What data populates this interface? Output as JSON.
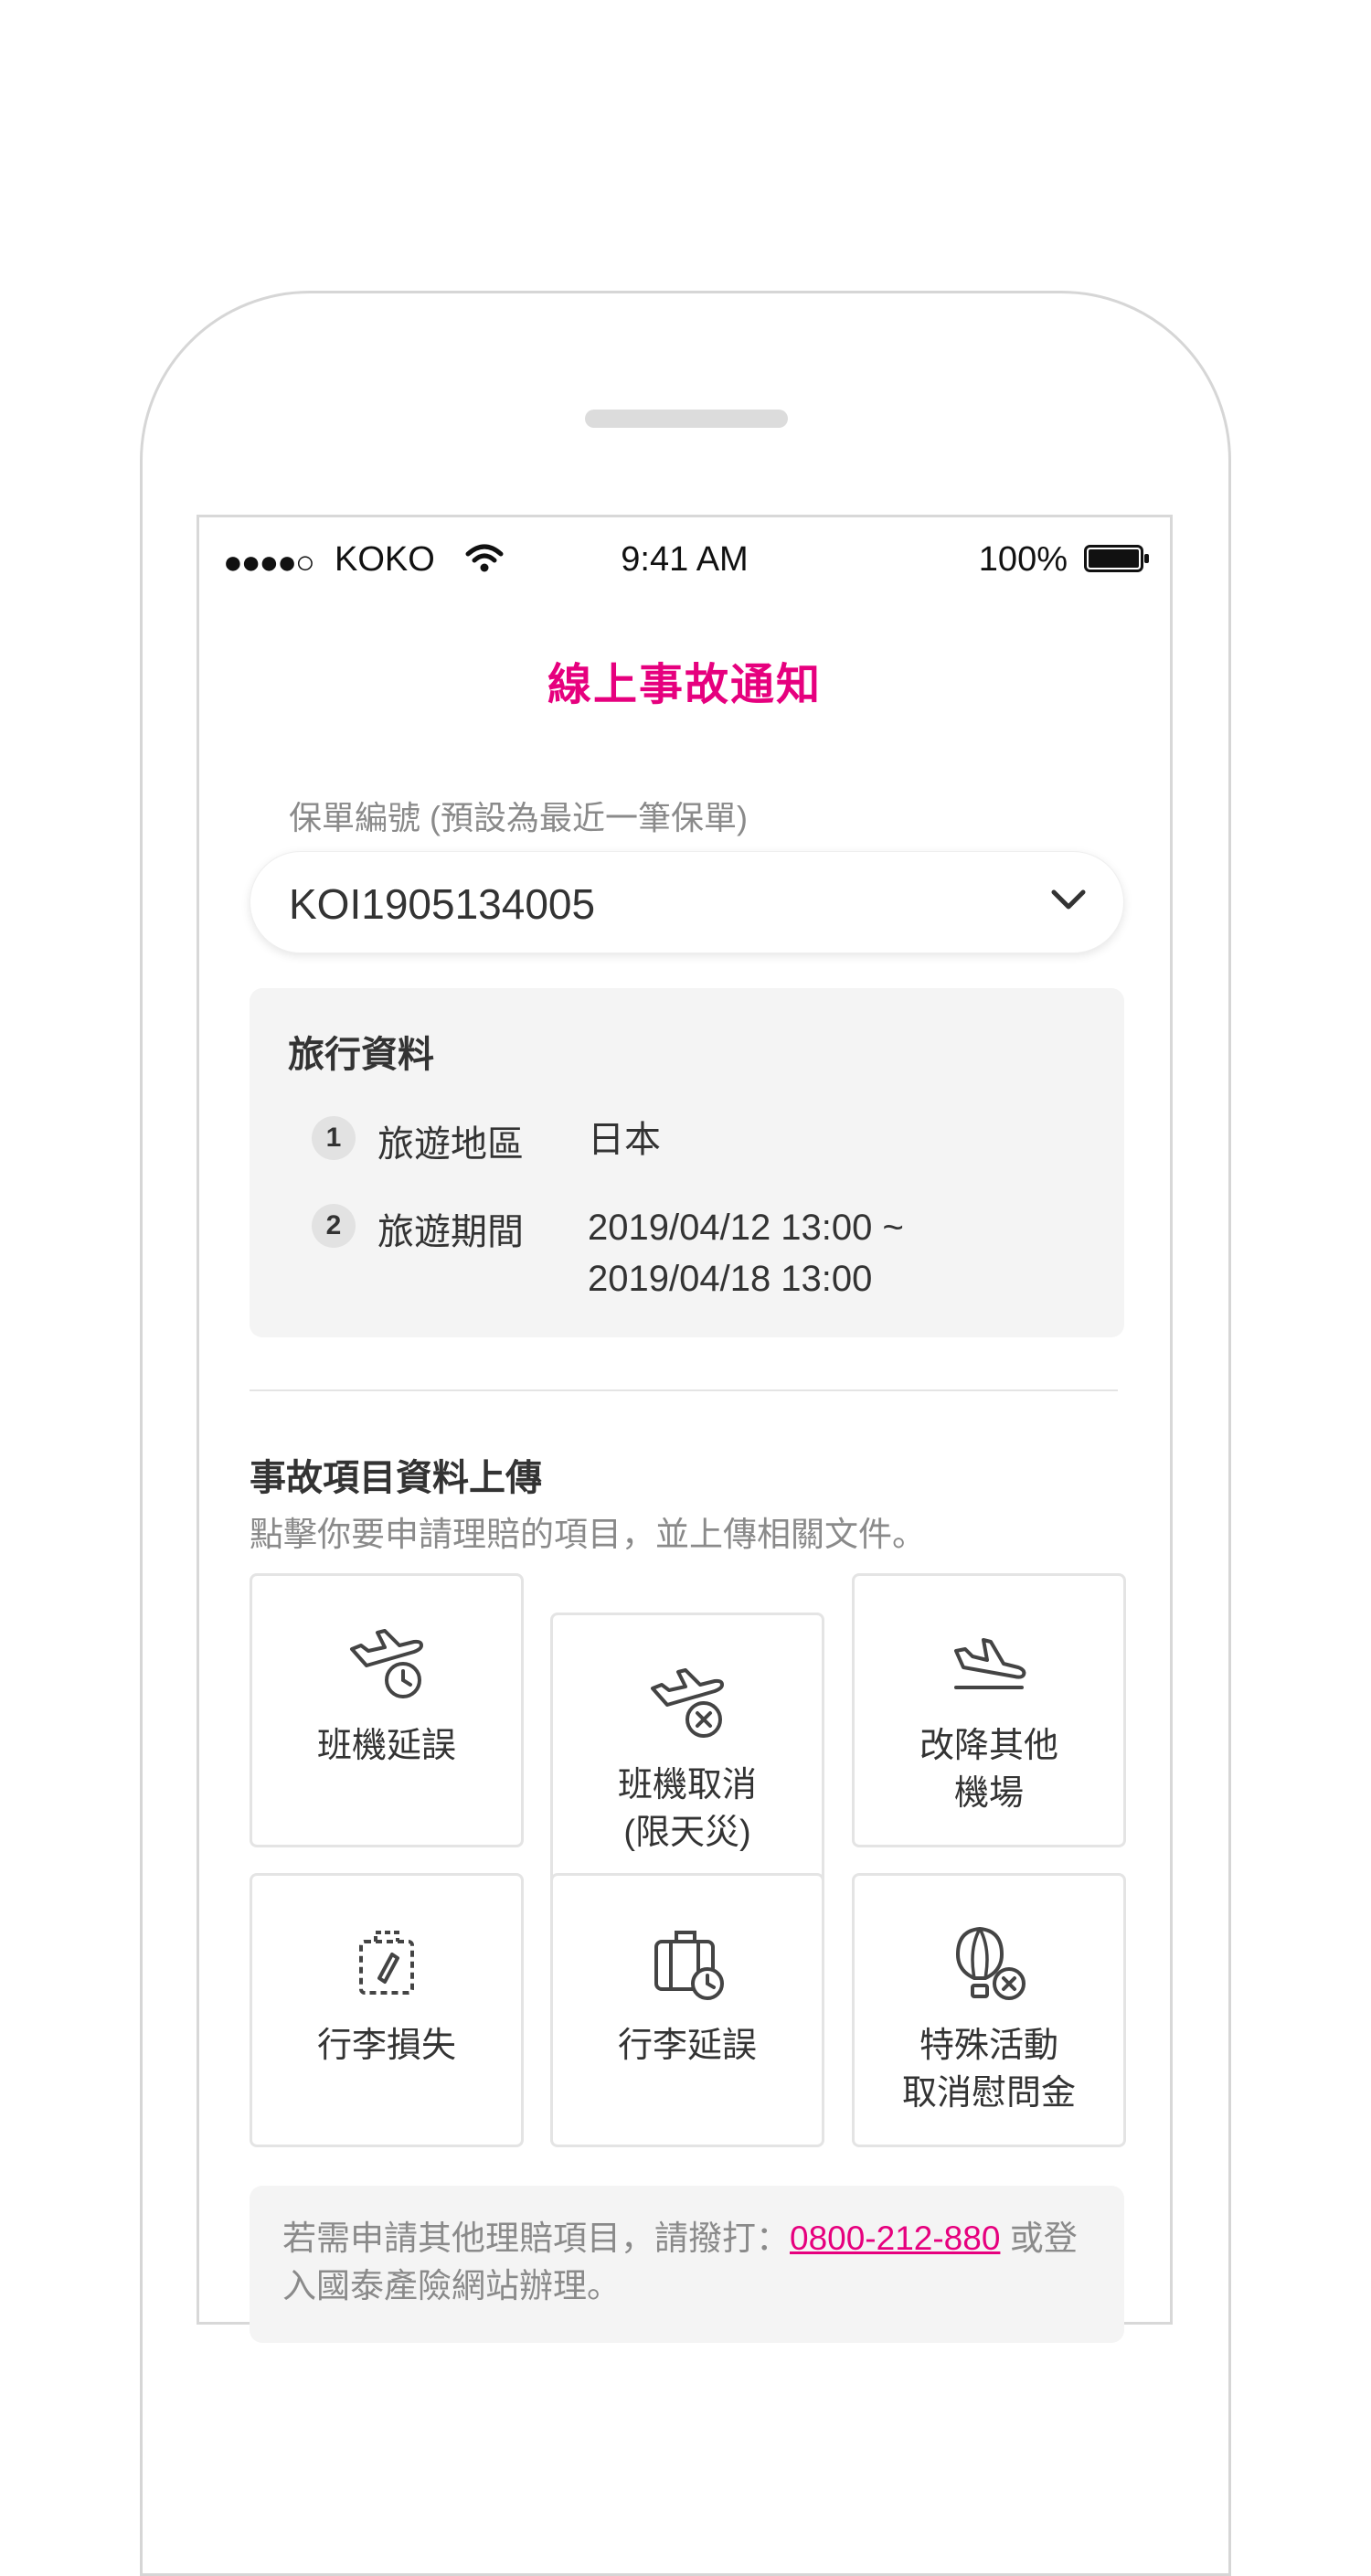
{
  "status_bar": {
    "signal": "●●●●○",
    "carrier": "KOKO",
    "time": "9:41 AM",
    "battery_pct": "100%"
  },
  "page": {
    "title": "線上事故通知"
  },
  "policy": {
    "label": "保單編號 (預設為最近一筆保單)",
    "value": "KOI1905134005"
  },
  "trip": {
    "heading": "旅行資料",
    "rows": [
      {
        "num": "1",
        "key": "旅遊地區",
        "value": "日本"
      },
      {
        "num": "2",
        "key": "旅遊期間",
        "value_line1": "2019/04/12 13:00 ~",
        "value_line2": "2019/04/18 13:00"
      }
    ]
  },
  "incident": {
    "title": "事故項目資料上傳",
    "desc": "點擊你要申請理賠的項目，並上傳相關文件。",
    "items": [
      {
        "label": "班機延誤",
        "icon": "flight-delay-icon"
      },
      {
        "label": "班機取消\n(限天災)",
        "icon": "flight-cancel-icon"
      },
      {
        "label": "改降其他\n機場",
        "icon": "plane-landing-icon"
      },
      {
        "label": "行李損失",
        "icon": "luggage-loss-icon"
      },
      {
        "label": "行李延誤",
        "icon": "luggage-delay-icon"
      },
      {
        "label": "特殊活動\n取消慰問金",
        "icon": "balloon-cancel-icon"
      }
    ]
  },
  "note": {
    "prefix": "若需申請其他理賠項目，請撥打：",
    "phone": "0800-212-880",
    "suffix": " 或登入國泰產險網站辦理。"
  },
  "colors": {
    "accent": "#e6007e",
    "text": "#333333",
    "muted": "#8a8a8a",
    "panel": "#f4f4f4"
  }
}
